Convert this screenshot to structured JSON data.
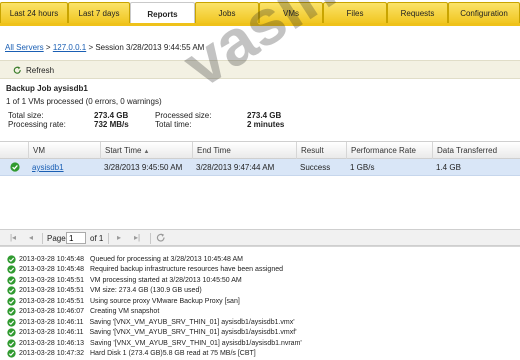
{
  "tabs": [
    {
      "label": "Last 24 hours"
    },
    {
      "label": "Last 7 days"
    },
    {
      "label": "Reports"
    },
    {
      "label": "Jobs"
    },
    {
      "label": "VMs"
    },
    {
      "label": "Files"
    },
    {
      "label": "Requests"
    },
    {
      "label": "Configuration"
    }
  ],
  "active_tab": "Reports",
  "breadcrumb": {
    "root": "All Servers",
    "sep1": ">",
    "server": "127.0.0.1",
    "sep2": ">",
    "session": "Session 3/28/2013 9:44:55 AM"
  },
  "toolbar": {
    "refresh_label": "Refresh"
  },
  "job": {
    "title": "Backup Job aysisdb1",
    "status": "1 of 1 VMs processed (0 errors, 0 warnings)",
    "total_size_label": "Total size:",
    "total_size": "273.4 GB",
    "processing_rate_label": "Processing rate:",
    "processing_rate": "732 MB/s",
    "processed_size_label": "Processed size:",
    "processed_size": "273.4 GB",
    "total_time_label": "Total time:",
    "total_time": "2 minutes"
  },
  "grid": {
    "columns": [
      "VM",
      "Start Time",
      "End Time",
      "Result",
      "Performance Rate",
      "Data Transferred"
    ],
    "rows": [
      {
        "vm": "aysisdb1",
        "start": "3/28/2013 9:45:50 AM",
        "end": "3/28/2013 9:47:44 AM",
        "result": "Success",
        "rate": "1 GB/s",
        "transferred": "1.4 GB"
      }
    ]
  },
  "pager": {
    "page_label": "Page",
    "page_value": "1",
    "of_label": "of 1"
  },
  "log": [
    {
      "time": "2013-03-28 10:45:48",
      "text": "Queued for processing at 3/28/2013 10:45:48 AM"
    },
    {
      "time": "2013-03-28 10:45:48",
      "text": "Required backup infrastructure resources have been assigned"
    },
    {
      "time": "2013-03-28 10:45:51",
      "text": "VM processing started at 3/28/2013 10:45:50 AM"
    },
    {
      "time": "2013-03-28 10:45:51",
      "text": "VM size: 273.4 GB (130.9 GB used)"
    },
    {
      "time": "2013-03-28 10:45:51",
      "text": "Using source proxy VMware Backup Proxy [san]"
    },
    {
      "time": "2013-03-28 10:46:07",
      "text": "Creating VM snapshot"
    },
    {
      "time": "2013-03-28 10:46:11",
      "text": "Saving '[VNX_VM_AYUB_SRV_THIN_01] aysisdb1/aysisdb1.vmx'"
    },
    {
      "time": "2013-03-28 10:46:11",
      "text": "Saving '[VNX_VM_AYUB_SRV_THIN_01] aysisdb1/aysisdb1.vmxf'"
    },
    {
      "time": "2013-03-28 10:46:13",
      "text": "Saving '[VNX_VM_AYUB_SRV_THIN_01] aysisdb1/aysisdb1.nvram'"
    },
    {
      "time": "2013-03-28 10:47:32",
      "text": "Hard Disk 1 (273.4 GB)5.8 GB read at 75 MB/s [CBT]"
    }
  ],
  "watermark": "vasinakili.com",
  "colors": {
    "tab_yellow": "#f0c51d",
    "link": "#1a5fb4",
    "selected_row": "#d9e6f7",
    "success_green": "#2f9a2f"
  },
  "icons": {
    "refresh": "refresh-icon",
    "success": "check-circle-icon"
  }
}
